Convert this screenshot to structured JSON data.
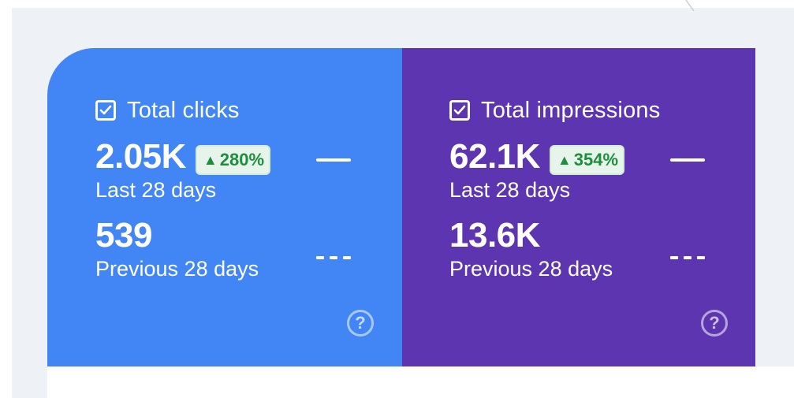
{
  "metrics": [
    {
      "key": "clicks",
      "title": "Total clicks",
      "checked": true,
      "current_value": "2.05K",
      "current_label": "Last 28 days",
      "change": "280%",
      "change_icon": "triangle-up-icon",
      "previous_value": "539",
      "previous_label": "Previous 28 days",
      "help_icon": "?",
      "color": "#4285f4"
    },
    {
      "key": "impressions",
      "title": "Total impressions",
      "checked": true,
      "current_value": "62.1K",
      "current_label": "Last 28 days",
      "change": "354%",
      "change_icon": "triangle-up-icon",
      "previous_value": "13.6K",
      "previous_label": "Previous 28 days",
      "help_icon": "?",
      "color": "#5e35b1"
    }
  ],
  "badge_colors": {
    "background": "#e6f4ea",
    "text": "#1e8e3e"
  }
}
